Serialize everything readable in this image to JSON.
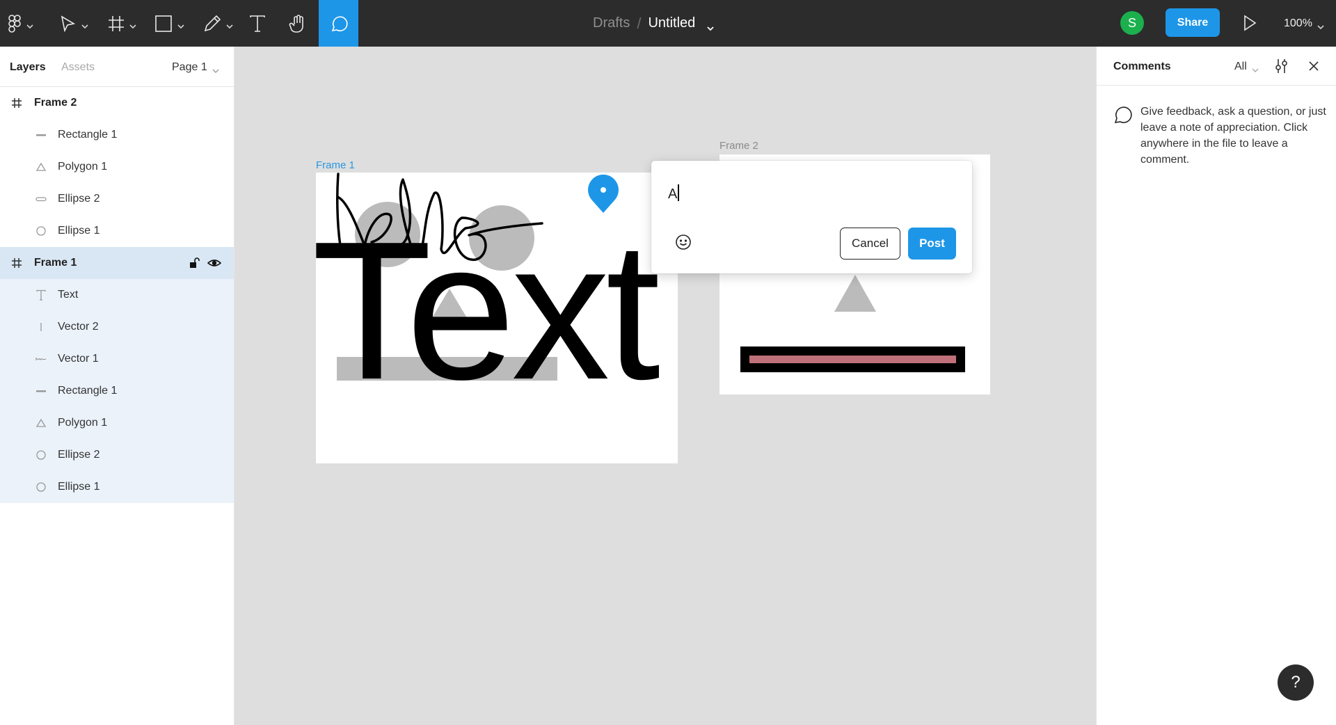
{
  "toolbar": {
    "tools": [
      {
        "name": "main-menu",
        "icon": "figma-logo-icon",
        "has_dropdown": true
      },
      {
        "name": "move-tool",
        "icon": "cursor-arrow-icon",
        "has_dropdown": true
      },
      {
        "name": "frame-tool",
        "icon": "frame-hash-icon",
        "has_dropdown": true
      },
      {
        "name": "shape-tool",
        "icon": "rectangle-icon",
        "has_dropdown": true
      },
      {
        "name": "pen-tool",
        "icon": "pencil-icon",
        "has_dropdown": true
      },
      {
        "name": "text-tool",
        "icon": "text-icon",
        "has_dropdown": false
      },
      {
        "name": "hand-tool",
        "icon": "hand-icon",
        "has_dropdown": false
      },
      {
        "name": "comment-tool",
        "icon": "comment-bubble-icon",
        "has_dropdown": false,
        "active": true
      }
    ],
    "breadcrumb": {
      "parent": "Drafts",
      "separator": "/",
      "title": "Untitled"
    },
    "avatar_initial": "S",
    "share_label": "Share",
    "zoom_level": "100%"
  },
  "left_panel": {
    "tabs": [
      {
        "label": "Layers",
        "active": true
      },
      {
        "label": "Assets",
        "active": false
      }
    ],
    "page_selector": "Page 1",
    "layers": [
      {
        "label": "Frame 2",
        "type": "frame",
        "icon": "frame-hash-icon",
        "depth": 0,
        "selected": false
      },
      {
        "label": "Rectangle 1",
        "type": "rectangle",
        "icon": "line-icon",
        "depth": 1,
        "selected": false
      },
      {
        "label": "Polygon 1",
        "type": "polygon",
        "icon": "triangle-icon",
        "depth": 1,
        "selected": false
      },
      {
        "label": "Ellipse 2",
        "type": "ellipse",
        "icon": "flat-ellipse-icon",
        "depth": 1,
        "selected": false
      },
      {
        "label": "Ellipse 1",
        "type": "ellipse",
        "icon": "circle-icon",
        "depth": 1,
        "selected": false
      },
      {
        "label": "Frame 1",
        "type": "frame",
        "icon": "frame-hash-icon",
        "depth": 0,
        "selected": true
      },
      {
        "label": "Text",
        "type": "text",
        "icon": "text-icon",
        "depth": 1,
        "selected": true
      },
      {
        "label": "Vector 2",
        "type": "vector",
        "icon": "vertical-line-icon",
        "depth": 1,
        "selected": true
      },
      {
        "label": "Vector 1",
        "type": "vector",
        "icon": "scribble-icon",
        "depth": 1,
        "selected": true
      },
      {
        "label": "Rectangle 1",
        "type": "rectangle",
        "icon": "line-icon",
        "depth": 1,
        "selected": true
      },
      {
        "label": "Polygon 1",
        "type": "polygon",
        "icon": "triangle-icon",
        "depth": 1,
        "selected": true
      },
      {
        "label": "Ellipse 2",
        "type": "ellipse",
        "icon": "circle-icon",
        "depth": 1,
        "selected": true
      },
      {
        "label": "Ellipse 1",
        "type": "ellipse",
        "icon": "circle-icon",
        "depth": 1,
        "selected": true
      }
    ]
  },
  "canvas": {
    "frames": [
      {
        "label": "Frame 1",
        "text_content": "Text",
        "scribble_text": "hello"
      },
      {
        "label": "Frame 2"
      }
    ],
    "comment_draft": {
      "value": "A",
      "cancel_label": "Cancel",
      "post_label": "Post"
    }
  },
  "right_panel": {
    "title": "Comments",
    "filter": "All",
    "empty_message": "Give feedback, ask a question, or just leave a note of appreciation. Click anywhere in the file to leave a comment."
  },
  "help_label": "?",
  "colors": {
    "toolbar_bg": "#2c2c2c",
    "accent_blue": "#1e96e8",
    "avatar_green": "#1bb04d",
    "canvas_bg": "#dedede",
    "selection_bg": "#d9e7f4",
    "shape_gray": "#bbbbbb",
    "pink_fill": "#c07079"
  }
}
